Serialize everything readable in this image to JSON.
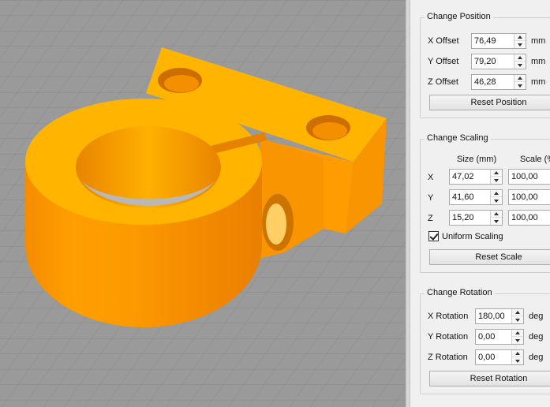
{
  "position": {
    "title": "Change Position",
    "x_label": "X Offset",
    "x_value": "76,49",
    "y_label": "Y Offset",
    "y_value": "79,20",
    "z_label": "Z Offset",
    "z_value": "46,28",
    "unit": "mm",
    "reset_label": "Reset Position"
  },
  "scaling": {
    "title": "Change Scaling",
    "size_header": "Size (mm)",
    "scale_header": "Scale (%",
    "rows": [
      {
        "axis": "X",
        "size": "47,02",
        "scale": "100,00"
      },
      {
        "axis": "Y",
        "size": "41,60",
        "scale": "100,00"
      },
      {
        "axis": "Z",
        "size": "15,20",
        "scale": "100,00"
      }
    ],
    "uniform_label": "Uniform Scaling",
    "uniform_checked": true,
    "reset_label": "Reset Scale"
  },
  "rotation": {
    "title": "Change Rotation",
    "x_label": "X Rotation",
    "x_value": "180,00",
    "y_label": "Y Rotation",
    "y_value": "0,00",
    "z_label": "Z Rotation",
    "z_value": "0,00",
    "unit": "deg",
    "reset_label": "Reset Rotation"
  },
  "colors": {
    "model_top": "#ffb300",
    "model_side": "#f99500",
    "build_plate": "#9a9a9a",
    "grid_line": "#8a8a8a"
  }
}
